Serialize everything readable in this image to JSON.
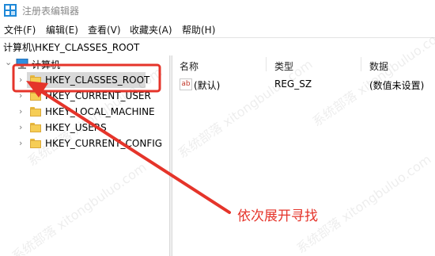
{
  "window": {
    "title": "注册表编辑器"
  },
  "menu": [
    "文件(F)",
    "编辑(E)",
    "查看(V)",
    "收藏夹(A)",
    "帮助(H)"
  ],
  "address": "计算机\\HKEY_CLASSES_ROOT",
  "tree": {
    "root": "计算机",
    "items": [
      "HKEY_CLASSES_ROOT",
      "HKEY_CURRENT_USER",
      "HKEY_LOCAL_MACHINE",
      "HKEY_USERS",
      "HKEY_CURRENT_CONFIG"
    ],
    "selected": "HKEY_CLASSES_ROOT"
  },
  "list": {
    "columns": [
      "名称",
      "类型",
      "数据"
    ],
    "rows": [
      {
        "icon": "string-value-icon",
        "icon_text": "ab",
        "name": "(默认)",
        "type": "REG_SZ",
        "data": "(数值未设置)"
      }
    ]
  },
  "annotation": {
    "text": "依次展开寻找",
    "color": "#e5342a"
  },
  "watermark": "系统部落 xitongbuluo.com"
}
